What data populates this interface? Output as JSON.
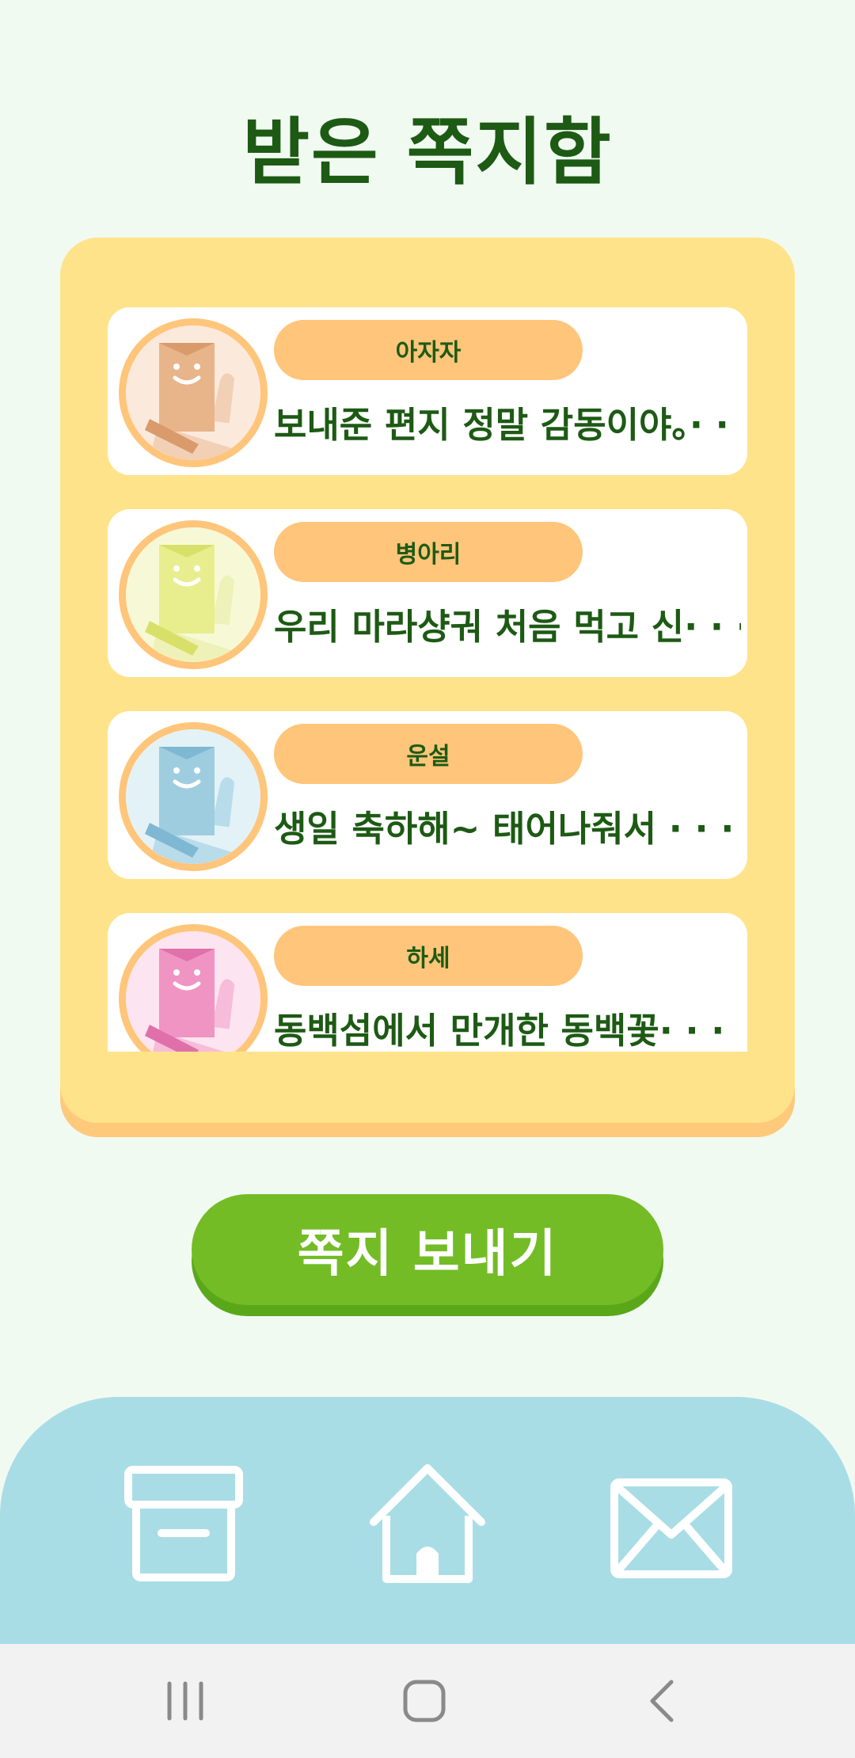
{
  "page": {
    "title": "받은 쪽지함"
  },
  "messages": [
    {
      "name": "아자자",
      "preview": "보내준 편지 정말 감동이야。· · ·",
      "avatar_color": "#e8b48a",
      "avatar_icon": "peach-envelope-character-icon"
    },
    {
      "name": "병아리",
      "preview": "우리 마라샹궈 처음 먹고 신· · ·",
      "avatar_color": "#e8ee8e",
      "avatar_icon": "yellow-envelope-character-icon"
    },
    {
      "name": "운설",
      "preview": "생일 축하해~ 태어나줘서 · · ·",
      "avatar_color": "#9fcde0",
      "avatar_icon": "blue-envelope-character-icon"
    },
    {
      "name": "하세",
      "preview": "동백섬에서 만개한 동백꽃· · ·",
      "avatar_color": "#f094c4",
      "avatar_icon": "pink-envelope-character-icon"
    }
  ],
  "send_button": {
    "label": "쪽지 보내기"
  },
  "bottom_nav": {
    "items": [
      {
        "icon": "archive-box-icon"
      },
      {
        "icon": "home-icon"
      },
      {
        "icon": "envelope-icon"
      }
    ]
  },
  "colors": {
    "title": "#1d5a14",
    "panel": "#ffe38a",
    "pill": "#ffc57a",
    "send_button": "#73bc26",
    "bottom_bar": "#a9dde6"
  }
}
